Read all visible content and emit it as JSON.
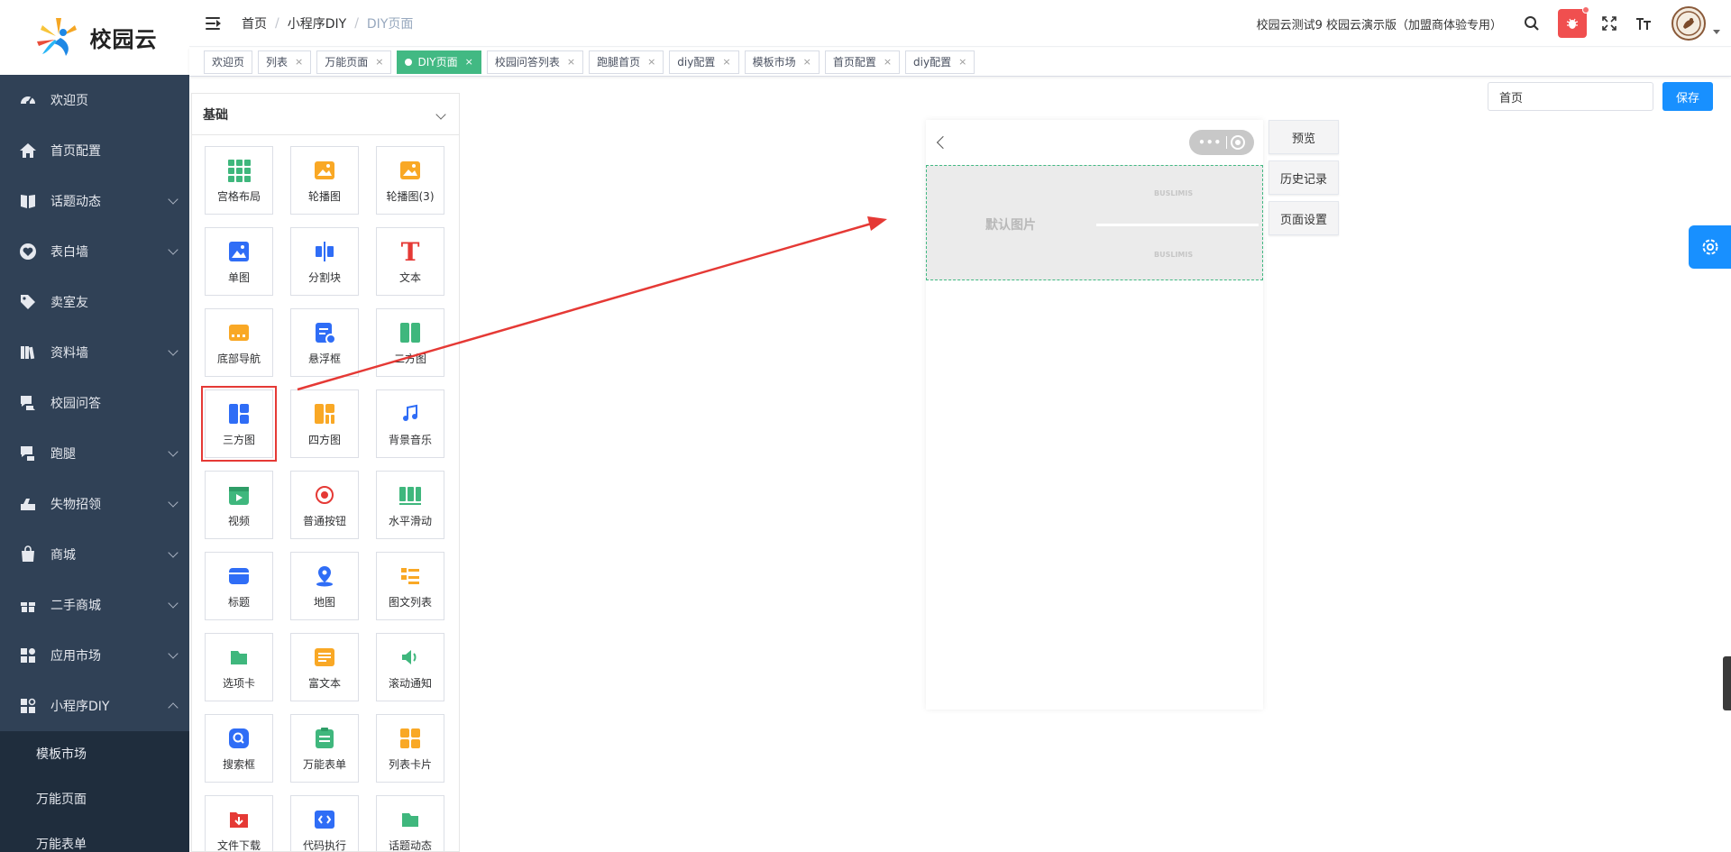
{
  "app": {
    "logo_text": "校园云"
  },
  "sidebar": {
    "items": [
      {
        "label": "欢迎页",
        "icon": "dashboard-icon",
        "has_children": false
      },
      {
        "label": "首页配置",
        "icon": "home-icon",
        "has_children": false
      },
      {
        "label": "话题动态",
        "icon": "book-icon",
        "has_children": true
      },
      {
        "label": "表白墙",
        "icon": "heart-icon",
        "has_children": true
      },
      {
        "label": "卖室友",
        "icon": "tag-icon",
        "has_children": false
      },
      {
        "label": "资料墙",
        "icon": "library-icon",
        "has_children": true
      },
      {
        "label": "校园问答",
        "icon": "qa-icon",
        "has_children": false
      },
      {
        "label": "跑腿",
        "icon": "errand-icon",
        "has_children": true
      },
      {
        "label": "失物招领",
        "icon": "lost-found-icon",
        "has_children": true
      },
      {
        "label": "商城",
        "icon": "shop-icon",
        "has_children": true
      },
      {
        "label": "二手商城",
        "icon": "gift-icon",
        "has_children": true
      },
      {
        "label": "应用市场",
        "icon": "apps-icon",
        "has_children": true
      },
      {
        "label": "小程序DIY",
        "icon": "diy-icon",
        "has_children": true,
        "expanded": true
      }
    ],
    "sub_items": [
      "模板市场",
      "万能页面",
      "万能表单"
    ]
  },
  "header": {
    "breadcrumb": [
      "首页",
      "小程序DIY",
      "DIY页面"
    ],
    "breadcrumb_sep": "/",
    "tenant": "校园云测试9 校园云演示版（加盟商体验专用）"
  },
  "tags": [
    {
      "label": "欢迎页",
      "closable": false,
      "active": false
    },
    {
      "label": "列表",
      "closable": true,
      "active": false
    },
    {
      "label": "万能页面",
      "closable": true,
      "active": false
    },
    {
      "label": "DIY页面",
      "closable": true,
      "active": true
    },
    {
      "label": "校园问答列表",
      "closable": true,
      "active": false
    },
    {
      "label": "跑腿首页",
      "closable": true,
      "active": false
    },
    {
      "label": "diy配置",
      "closable": true,
      "active": false
    },
    {
      "label": "模板市场",
      "closable": true,
      "active": false
    },
    {
      "label": "首页配置",
      "closable": true,
      "active": false
    },
    {
      "label": "diy配置",
      "closable": true,
      "active": false
    }
  ],
  "tag_close": "×",
  "components": {
    "section_title": "基础",
    "items": [
      {
        "label": "宫格布局",
        "icon": "grid-icon"
      },
      {
        "label": "轮播图",
        "icon": "carousel-icon"
      },
      {
        "label": "轮播图(3)",
        "icon": "carousel3-icon"
      },
      {
        "label": "单图",
        "icon": "image-icon"
      },
      {
        "label": "分割块",
        "icon": "divider-icon"
      },
      {
        "label": "文本",
        "icon": "text-icon"
      },
      {
        "label": "底部导航",
        "icon": "bottom-nav-icon"
      },
      {
        "label": "悬浮框",
        "icon": "float-icon"
      },
      {
        "label": "二方图",
        "icon": "two-image-icon"
      },
      {
        "label": "三方图",
        "icon": "three-image-icon",
        "highlighted": true
      },
      {
        "label": "四方图",
        "icon": "four-image-icon"
      },
      {
        "label": "背景音乐",
        "icon": "music-icon"
      },
      {
        "label": "视频",
        "icon": "video-icon"
      },
      {
        "label": "普通按钮",
        "icon": "button-icon"
      },
      {
        "label": "水平滑动",
        "icon": "slider-icon"
      },
      {
        "label": "标题",
        "icon": "title-icon"
      },
      {
        "label": "地图",
        "icon": "map-icon"
      },
      {
        "label": "图文列表",
        "icon": "list-icon"
      },
      {
        "label": "选项卡",
        "icon": "tabs-icon"
      },
      {
        "label": "富文本",
        "icon": "richtext-icon"
      },
      {
        "label": "滚动通知",
        "icon": "notice-icon"
      },
      {
        "label": "搜索框",
        "icon": "search-box-icon"
      },
      {
        "label": "万能表单",
        "icon": "form-icon"
      },
      {
        "label": "列表卡片",
        "icon": "card-icon"
      },
      {
        "label": "文件下载",
        "icon": "download-icon"
      },
      {
        "label": "代码执行",
        "icon": "code-icon"
      },
      {
        "label": "话题动态",
        "icon": "topic-icon"
      }
    ]
  },
  "preview": {
    "banner_text": "默认图片",
    "watermark": "BUSLIMIS"
  },
  "side_buttons": [
    "预览",
    "历史记录",
    "页面设置"
  ],
  "page_select": {
    "value": "首页"
  },
  "save_label": "保存",
  "colors": {
    "sidebar_bg": "#304156",
    "active_tag": "#42b983",
    "primary": "#1890ff",
    "annotation_red": "#e53935"
  }
}
